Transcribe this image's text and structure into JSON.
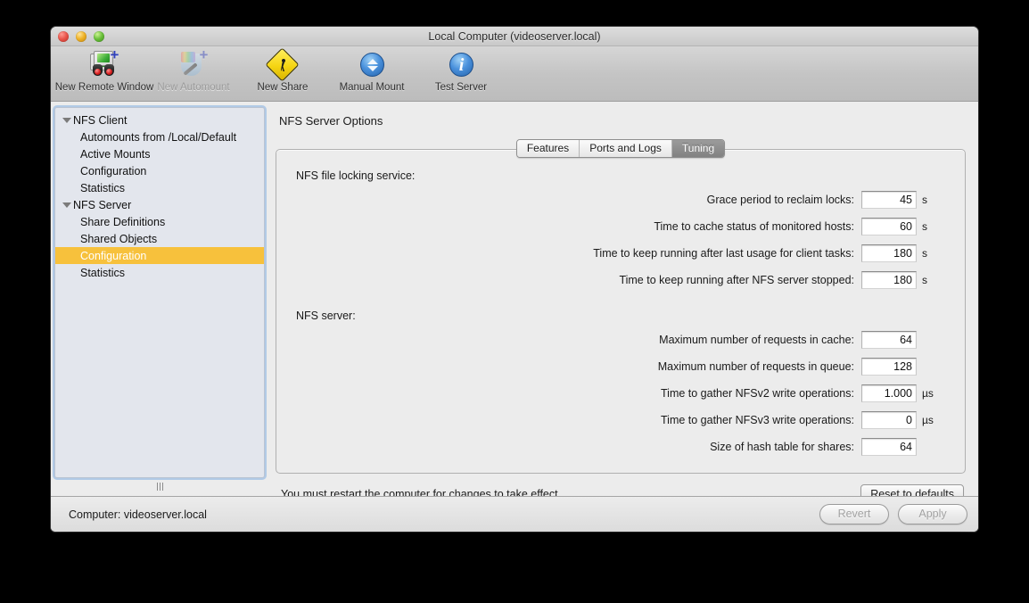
{
  "window": {
    "title": "Local Computer (videoserver.local)",
    "traffic_lights": [
      "close-button",
      "minimize-button",
      "zoom-button"
    ]
  },
  "toolbar": {
    "items": [
      {
        "label": "New Remote Window",
        "icon": "new-remote-window-icon",
        "disabled": false
      },
      {
        "label": "New Automount",
        "icon": "new-automount-icon",
        "disabled": true
      },
      {
        "label": "New Share",
        "icon": "new-share-icon",
        "disabled": false
      },
      {
        "label": "Manual Mount",
        "icon": "manual-mount-icon",
        "disabled": false
      },
      {
        "label": "Test Server",
        "icon": "test-server-icon",
        "disabled": false
      }
    ]
  },
  "sidebar": {
    "items": [
      {
        "label": "NFS Client",
        "level": 0,
        "expanded": true,
        "selected": false
      },
      {
        "label": "Automounts from /Local/Default",
        "level": 1,
        "selected": false
      },
      {
        "label": "Active Mounts",
        "level": 1,
        "selected": false
      },
      {
        "label": "Configuration",
        "level": 1,
        "selected": false
      },
      {
        "label": "Statistics",
        "level": 1,
        "selected": false
      },
      {
        "label": "NFS Server",
        "level": 0,
        "expanded": true,
        "selected": false
      },
      {
        "label": "Share Definitions",
        "level": 1,
        "selected": false
      },
      {
        "label": "Shared Objects",
        "level": 1,
        "selected": false
      },
      {
        "label": "Configuration",
        "level": 1,
        "selected": true
      },
      {
        "label": "Statistics",
        "level": 1,
        "selected": false
      }
    ],
    "selection_color": "#f7c13c"
  },
  "main": {
    "pane_title": "NFS Server Options",
    "tabs": [
      {
        "label": "Features",
        "active": false
      },
      {
        "label": "Ports and Logs",
        "active": false
      },
      {
        "label": "Tuning",
        "active": true
      }
    ],
    "groups": [
      {
        "label": "NFS file locking service:",
        "fields": [
          {
            "label": "Grace period to reclaim locks:",
            "value": "45",
            "unit": "s"
          },
          {
            "label": "Time to cache status of monitored hosts:",
            "value": "60",
            "unit": "s"
          },
          {
            "label": "Time to keep running after last usage for client tasks:",
            "value": "180",
            "unit": "s"
          },
          {
            "label": "Time to keep running after NFS server stopped:",
            "value": "180",
            "unit": "s"
          }
        ]
      },
      {
        "label": "NFS server:",
        "fields": [
          {
            "label": "Maximum number of requests in cache:",
            "value": "64",
            "unit": ""
          },
          {
            "label": "Maximum number of requests in queue:",
            "value": "128",
            "unit": ""
          },
          {
            "label": "Time to gather NFSv2 write operations:",
            "value": "1.000",
            "unit": "µs"
          },
          {
            "label": "Time to gather NFSv3 write operations:",
            "value": "0",
            "unit": "µs"
          },
          {
            "label": "Size of hash table for shares:",
            "value": "64",
            "unit": ""
          }
        ]
      }
    ],
    "restart_note": "You must restart the computer for changes to take effect.",
    "reset_button": "Reset to defaults"
  },
  "bottom": {
    "computer_label": "Computer: videoserver.local",
    "revert_button": "Revert",
    "apply_button": "Apply",
    "buttons_enabled": false
  }
}
